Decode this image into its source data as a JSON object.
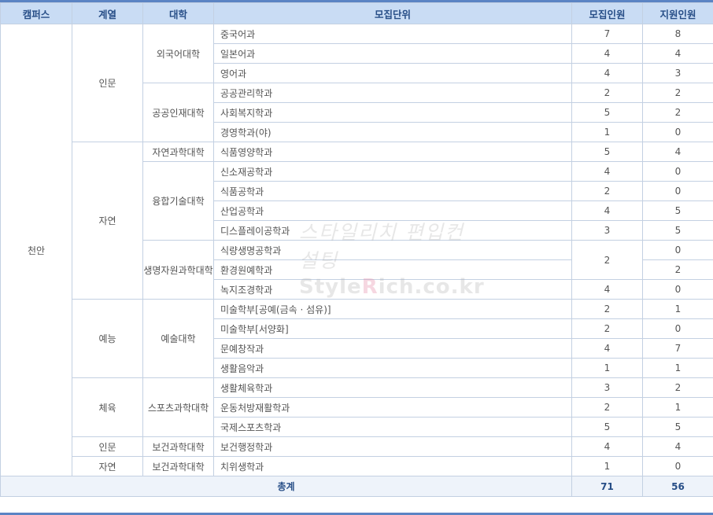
{
  "headers": {
    "campus": "캠퍼스",
    "track": "계열",
    "college": "대학",
    "unit": "모집단위",
    "quota": "모집인원",
    "applicants": "지원인원"
  },
  "campus": "천안",
  "tracks": {
    "humanities": "인문",
    "natural": "자연",
    "arts": "예능",
    "sports": "체육",
    "humanities2": "인문",
    "natural2": "자연"
  },
  "colleges": {
    "foreign": "외국어대학",
    "public": "공공인재대학",
    "science": "자연과학대학",
    "convergence": "융합기술대학",
    "bio": "생명자원과학대학",
    "art": "예술대학",
    "sport": "스포츠과학대학",
    "health1": "보건과학대학",
    "health2": "보건과학대학"
  },
  "rows": [
    {
      "unit": "중국어과",
      "quota": "7",
      "applicants": "8"
    },
    {
      "unit": "일본어과",
      "quota": "4",
      "applicants": "4"
    },
    {
      "unit": "영어과",
      "quota": "4",
      "applicants": "3"
    },
    {
      "unit": "공공관리학과",
      "quota": "2",
      "applicants": "2"
    },
    {
      "unit": "사회복지학과",
      "quota": "5",
      "applicants": "2"
    },
    {
      "unit": "경영학과(야)",
      "quota": "1",
      "applicants": "0"
    },
    {
      "unit": "식품영양학과",
      "quota": "5",
      "applicants": "4"
    },
    {
      "unit": "신소재공학과",
      "quota": "4",
      "applicants": "0"
    },
    {
      "unit": "식품공학과",
      "quota": "2",
      "applicants": "0"
    },
    {
      "unit": "산업공학과",
      "quota": "4",
      "applicants": "5"
    },
    {
      "unit": "디스플레이공학과",
      "quota": "3",
      "applicants": "5"
    },
    {
      "unit": "식량생명공학과",
      "quota": "2",
      "applicants": "0"
    },
    {
      "unit": "환경원예학과",
      "quota": "",
      "applicants": "2"
    },
    {
      "unit": "녹지조경학과",
      "quota": "4",
      "applicants": "0"
    },
    {
      "unit": "미술학부[공예(금속 · 섬유)]",
      "quota": "2",
      "applicants": "1"
    },
    {
      "unit": "미술학부[서양화]",
      "quota": "2",
      "applicants": "0"
    },
    {
      "unit": "문예창작과",
      "quota": "4",
      "applicants": "7"
    },
    {
      "unit": "생활음악과",
      "quota": "1",
      "applicants": "1"
    },
    {
      "unit": "생활체육학과",
      "quota": "3",
      "applicants": "2"
    },
    {
      "unit": "운동처방재활학과",
      "quota": "2",
      "applicants": "1"
    },
    {
      "unit": "국제스포츠학과",
      "quota": "5",
      "applicants": "5"
    },
    {
      "unit": "보건행정학과",
      "quota": "4",
      "applicants": "4"
    },
    {
      "unit": "치위생학과",
      "quota": "1",
      "applicants": "0"
    }
  ],
  "total": {
    "label": "총계",
    "quota": "71",
    "applicants": "56"
  },
  "watermark": {
    "korean": "스타일리치 편입컨설팅",
    "site_prefix": "Style",
    "site_highlight": "R",
    "site_suffix": "ich.co.kr"
  }
}
